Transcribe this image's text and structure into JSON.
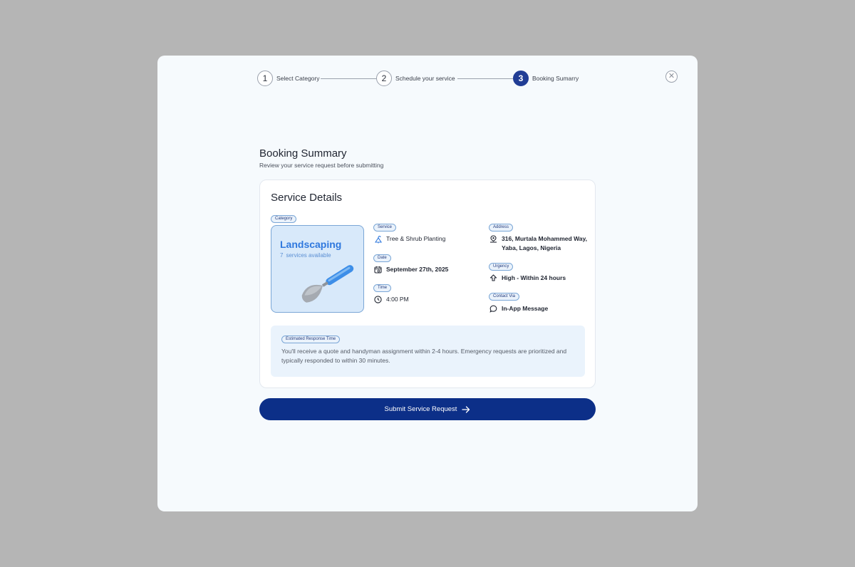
{
  "stepper": {
    "steps": [
      {
        "number": "1",
        "label": "Select Category"
      },
      {
        "number": "2",
        "label": "Schedule your service"
      },
      {
        "number": "3",
        "label": "Booking Sumarry"
      }
    ],
    "active_step": 3
  },
  "close_icon": "close-icon",
  "header": {
    "title": "Booking Summary",
    "subtitle": "Review your service request before submitting"
  },
  "card": {
    "title": "Service Details",
    "category": {
      "chip": "Category",
      "name": "Landscaping",
      "count": "7",
      "count_label": "services available",
      "icon": "trowel-icon"
    },
    "service": {
      "chip": "Service",
      "value": "Tree & Shrub Planting",
      "icon": "plant-icon"
    },
    "date": {
      "chip": "Date",
      "value": "September 27th, 2025",
      "icon": "calendar-icon"
    },
    "time": {
      "chip": "Time",
      "value": "4:00 PM",
      "icon": "clock-icon"
    },
    "address": {
      "chip": "Address",
      "line1": "316, Murtala Mohammed Way,",
      "line2": "Yaba, Lagos, Nigeria",
      "icon": "location-icon"
    },
    "urgency": {
      "chip": "Urgency",
      "value": "High - Within 24 hours",
      "icon": "arrow-up-icon"
    },
    "contact": {
      "chip": "Contact Via",
      "value": "In-App Message",
      "icon": "chat-icon"
    },
    "response": {
      "chip": "Estimated Response Time",
      "text": "You'll receive a quote and handyman assignment within 2-4 hours. Emergency requests are prioritized and typically responded to within 30 minutes."
    }
  },
  "submit": {
    "label": "Submit Service Request",
    "icon": "arrow-right-icon"
  },
  "colors": {
    "primary": "#0c2f88",
    "active_step": "#213d95",
    "category_bg": "#d8e9fa",
    "category_text": "#2f78de",
    "overlay": "#b5b5b5",
    "modal_bg": "#f6fafd"
  }
}
